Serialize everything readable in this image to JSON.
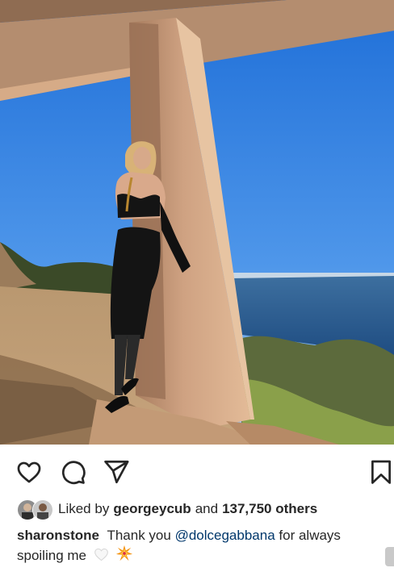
{
  "post": {
    "image": {
      "alt_icon": "photo-post-icon"
    },
    "actions": {
      "like_icon": "heart-icon",
      "comment_icon": "comment-icon",
      "share_icon": "send-icon",
      "save_icon": "bookmark-icon"
    },
    "likes": {
      "prefix": "Liked by",
      "user": "georgeycub",
      "connector": "and",
      "count": "137,750 others"
    },
    "caption": {
      "username": "sharonstone",
      "text_before": "Thank you",
      "mention": "@dolcegabbana",
      "text_after": "for always spoiling me",
      "emojis": [
        "white-heart-icon",
        "collision-icon"
      ]
    }
  },
  "colors": {
    "text": "#262626",
    "mention": "#00376b",
    "sky": "#2a7be0",
    "concrete": "#c99a78"
  }
}
